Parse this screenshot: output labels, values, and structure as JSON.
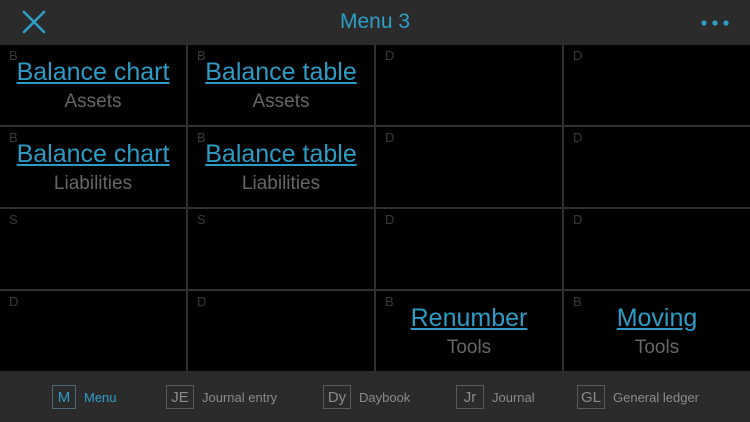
{
  "header": {
    "title": "Menu 3"
  },
  "grid": [
    {
      "type": "B",
      "link": "Balance chart",
      "sub": "Assets"
    },
    {
      "type": "B",
      "link": "Balance table",
      "sub": "Assets"
    },
    {
      "type": "D",
      "link": "",
      "sub": ""
    },
    {
      "type": "D",
      "link": "",
      "sub": ""
    },
    {
      "type": "B",
      "link": "Balance chart",
      "sub": "Liabilities"
    },
    {
      "type": "B",
      "link": "Balance table",
      "sub": "Liabilities"
    },
    {
      "type": "D",
      "link": "",
      "sub": ""
    },
    {
      "type": "D",
      "link": "",
      "sub": ""
    },
    {
      "type": "S",
      "link": "",
      "sub": ""
    },
    {
      "type": "S",
      "link": "",
      "sub": ""
    },
    {
      "type": "D",
      "link": "",
      "sub": ""
    },
    {
      "type": "D",
      "link": "",
      "sub": ""
    },
    {
      "type": "D",
      "link": "",
      "sub": ""
    },
    {
      "type": "D",
      "link": "",
      "sub": ""
    },
    {
      "type": "B",
      "link": "Renumber",
      "sub": "Tools"
    },
    {
      "type": "B",
      "link": "Moving",
      "sub": "Tools"
    }
  ],
  "tabs": [
    {
      "icon": "M",
      "label": "Menu"
    },
    {
      "icon": "JE",
      "label": "Journal entry"
    },
    {
      "icon": "Dy",
      "label": "Daybook"
    },
    {
      "icon": "Jr",
      "label": "Journal"
    },
    {
      "icon": "GL",
      "label": "General ledger"
    }
  ],
  "colors": {
    "accent": "#2e9ec6",
    "cell_bg": "#000000",
    "bar_bg": "#2b2b2b"
  }
}
